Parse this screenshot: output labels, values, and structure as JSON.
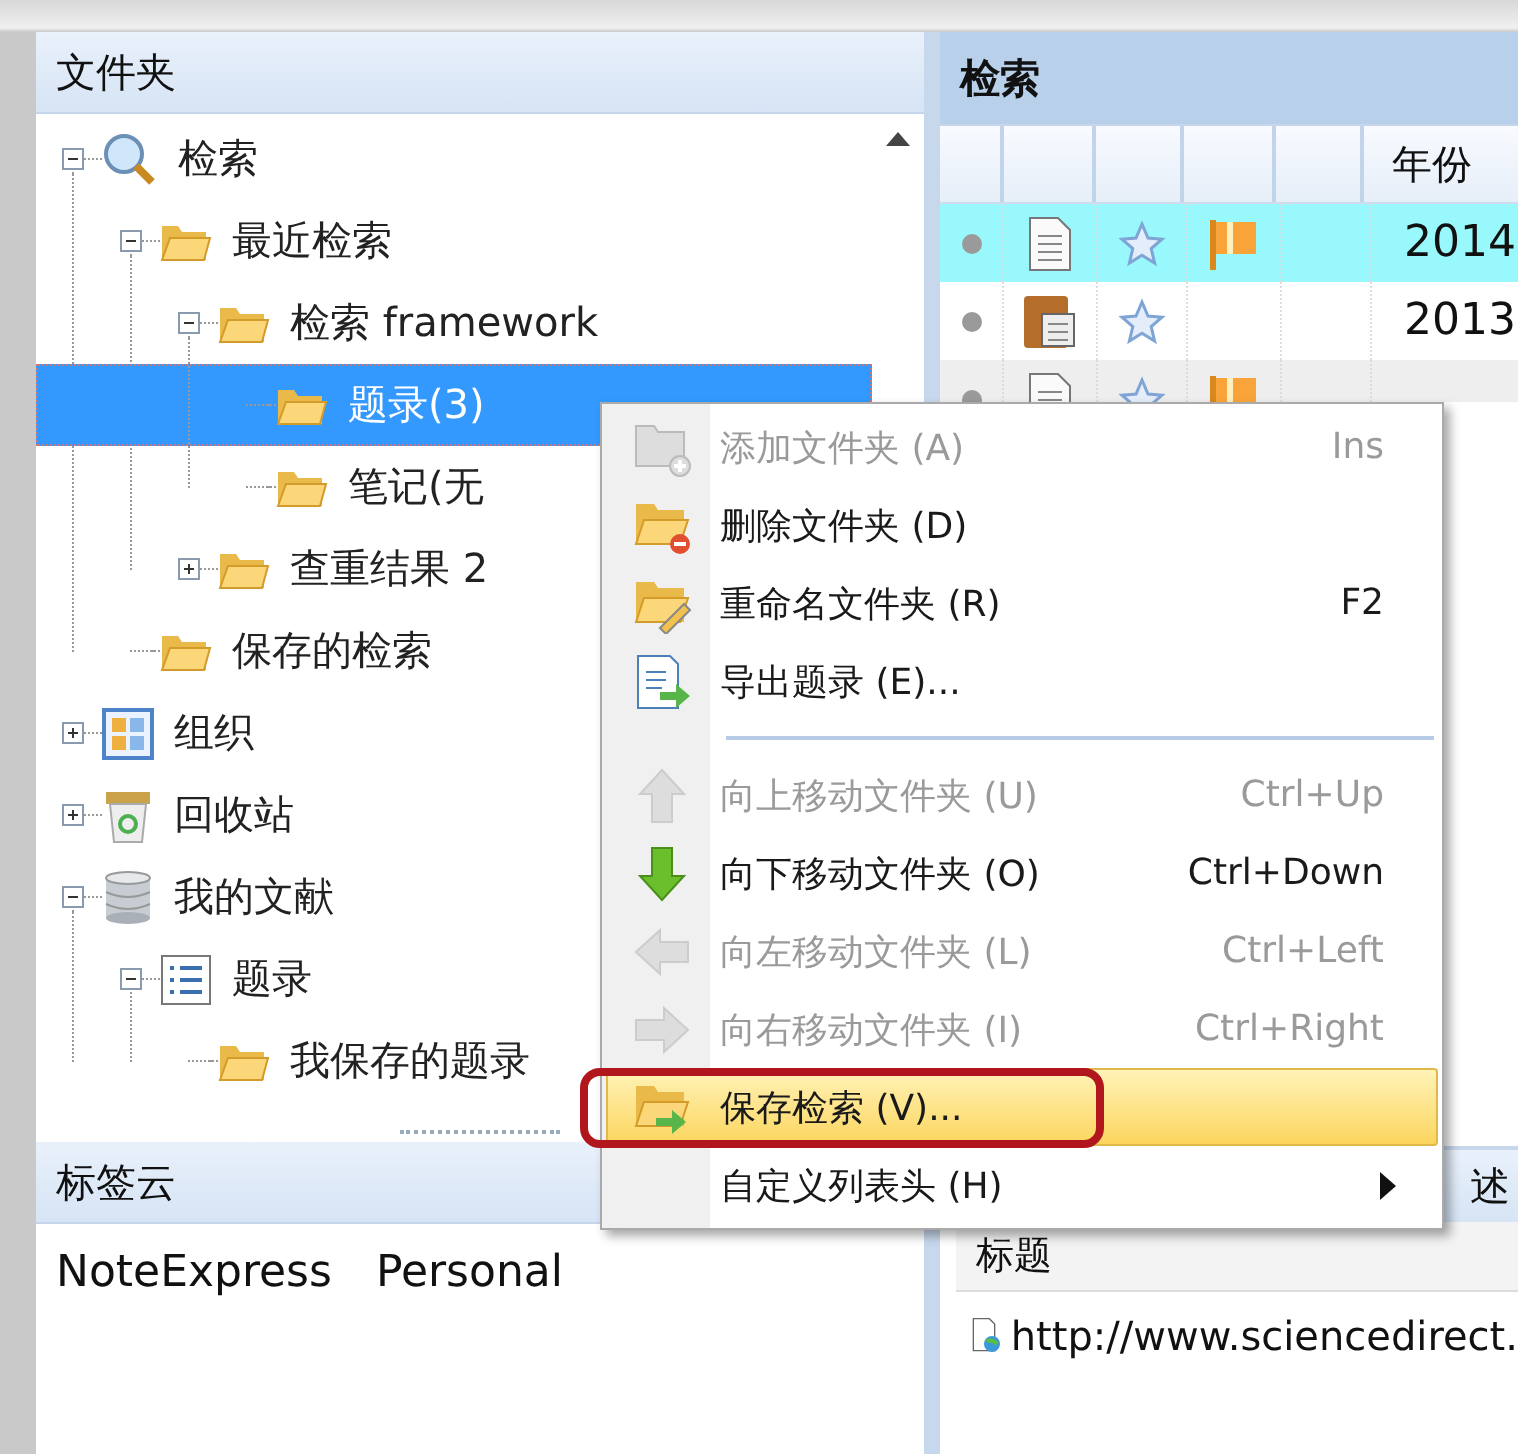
{
  "folders_panel": {
    "title": "文件夹",
    "tree": [
      {
        "children": [
          {
            "label": "检索",
            "kind": "search",
            "expanded": true,
            "selected": false,
            "children": [
              {
                "label": "最近检索",
                "kind": "folder",
                "expanded": true,
                "selected": false,
                "children": [
                  {
                    "label": "检索 framework",
                    "kind": "folder",
                    "expanded": true,
                    "selected": false,
                    "children": [
                      {
                        "label": "题录(3)",
                        "kind": "folder",
                        "selected": true
                      },
                      {
                        "label": "笔记(无",
                        "kind": "folder",
                        "selected": false
                      }
                    ]
                  },
                  {
                    "label": "查重结果 2",
                    "kind": "folder",
                    "expanded": false,
                    "selected": false
                  }
                ]
              },
              {
                "label": "保存的检索",
                "kind": "folder",
                "selected": false
              }
            ]
          },
          {
            "label": "组织",
            "kind": "grid",
            "expanded": false,
            "selected": false
          },
          {
            "label": "回收站",
            "kind": "bin",
            "expanded": false,
            "selected": false
          }
        ]
      },
      {
        "label": "我的文献",
        "kind": "database",
        "expanded": true,
        "selected": false,
        "children": [
          {
            "label": "题录",
            "kind": "list",
            "expanded": true,
            "selected": false,
            "children": [
              {
                "label": "我保存的题录",
                "kind": "folder",
                "selected": false
              }
            ]
          }
        ]
      }
    ]
  },
  "tag_cloud": {
    "title": "标签云",
    "tags": [
      "NoteExpress",
      "Personal"
    ]
  },
  "search_panel": {
    "title": "检索",
    "year_column": "年份",
    "rows": [
      {
        "selected": true,
        "kind": "document",
        "flag": true,
        "year": "2014"
      },
      {
        "selected": false,
        "kind": "book",
        "flag": false,
        "year": "2013"
      },
      {
        "selected": false,
        "kind": "document",
        "flag": true
      }
    ]
  },
  "detail_panel": {
    "tab": "述",
    "column": "标题",
    "rows": [
      "http://www.sciencedirect."
    ]
  },
  "context_menu": [
    {
      "kind": "item",
      "label": "添加文件夹 (A)",
      "shortcut": "Ins",
      "disabled": true,
      "selected": false
    },
    {
      "kind": "item",
      "label": "删除文件夹 (D)",
      "disabled": false,
      "selected": false
    },
    {
      "kind": "item",
      "label": "重命名文件夹 (R)",
      "shortcut": "F2",
      "disabled": false,
      "selected": false
    },
    {
      "kind": "item",
      "label": "导出题录 (E)...",
      "disabled": false,
      "selected": false
    },
    {
      "kind": "separator"
    },
    {
      "kind": "item",
      "label": "向上移动文件夹 (U)",
      "shortcut": "Ctrl+Up",
      "disabled": true,
      "selected": false
    },
    {
      "kind": "item",
      "label": "向下移动文件夹 (O)",
      "shortcut": "Ctrl+Down",
      "disabled": false,
      "selected": false
    },
    {
      "kind": "item",
      "label": "向左移动文件夹 (L)",
      "shortcut": "Ctrl+Left",
      "disabled": true,
      "selected": false
    },
    {
      "kind": "item",
      "label": "向右移动文件夹 (I)",
      "shortcut": "Ctrl+Right",
      "disabled": true,
      "selected": false
    },
    {
      "kind": "item",
      "label": "保存检索 (V)...",
      "disabled": false,
      "selected": true,
      "annotated": true
    },
    {
      "kind": "item",
      "label": "自定义列表头 (H)",
      "disabled": false,
      "selected": false,
      "submenu": true
    }
  ]
}
